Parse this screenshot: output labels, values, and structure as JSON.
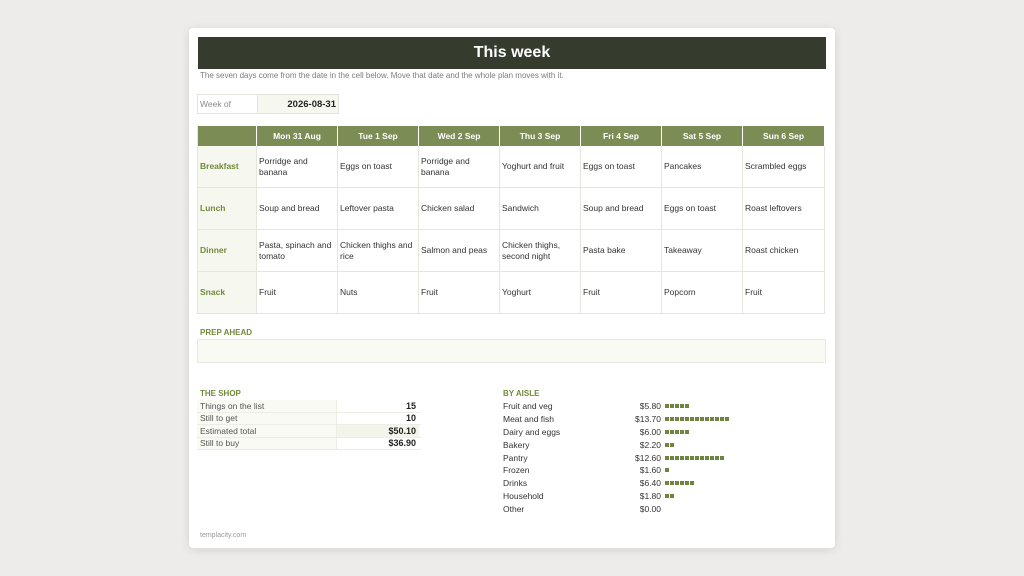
{
  "header": {
    "title": "This week",
    "subtitle": "The seven days come from the date in the cell below. Move that date and the whole plan moves with it."
  },
  "week_of": {
    "label": "Week of",
    "value": "2026-08-31"
  },
  "plan": {
    "days": [
      "Mon 31 Aug",
      "Tue 1 Sep",
      "Wed 2 Sep",
      "Thu 3 Sep",
      "Fri 4 Sep",
      "Sat 5 Sep",
      "Sun 6 Sep"
    ],
    "meals": [
      {
        "name": "Breakfast",
        "items": [
          "Porridge and banana",
          "Eggs on toast",
          "Porridge and banana",
          "Yoghurt and fruit",
          "Eggs on toast",
          "Pancakes",
          "Scrambled eggs"
        ]
      },
      {
        "name": "Lunch",
        "items": [
          "Soup and bread",
          "Leftover pasta",
          "Chicken salad",
          "Sandwich",
          "Soup and bread",
          "Eggs on toast",
          "Roast leftovers"
        ]
      },
      {
        "name": "Dinner",
        "items": [
          "Pasta, spinach and tomato",
          "Chicken thighs and rice",
          "Salmon and peas",
          "Chicken thighs, second night",
          "Pasta bake",
          "Takeaway",
          "Roast chicken"
        ]
      },
      {
        "name": "Snack",
        "items": [
          "Fruit",
          "Nuts",
          "Fruit",
          "Yoghurt",
          "Fruit",
          "Popcorn",
          "Fruit"
        ]
      }
    ]
  },
  "prep": {
    "title": "PREP AHEAD",
    "value": ""
  },
  "shop": {
    "title": "THE SHOP",
    "rows": [
      {
        "label": "Things on the list",
        "value": "15"
      },
      {
        "label": "Still to get",
        "value": "10"
      },
      {
        "label": "Estimated total",
        "value": "$50.10"
      },
      {
        "label": "Still to buy",
        "value": "$36.90"
      }
    ]
  },
  "aisle": {
    "title": "BY AISLE",
    "bar_color": "#6e8440",
    "rows": [
      {
        "name": "Fruit and veg",
        "amount": "$5.80",
        "blocks": 5
      },
      {
        "name": "Meat and fish",
        "amount": "$13.70",
        "blocks": 13
      },
      {
        "name": "Dairy and eggs",
        "amount": "$6.00",
        "blocks": 5
      },
      {
        "name": "Bakery",
        "amount": "$2.20",
        "blocks": 2
      },
      {
        "name": "Pantry",
        "amount": "$12.60",
        "blocks": 12
      },
      {
        "name": "Frozen",
        "amount": "$1.60",
        "blocks": 1
      },
      {
        "name": "Drinks",
        "amount": "$6.40",
        "blocks": 6
      },
      {
        "name": "Household",
        "amount": "$1.80",
        "blocks": 2
      },
      {
        "name": "Other",
        "amount": "$0.00",
        "blocks": 0
      }
    ]
  },
  "footer": {
    "text": "templacity.com"
  },
  "colors": {
    "banner": "#353c2e",
    "accent": "#7c8c55",
    "label": "#728a3c"
  }
}
